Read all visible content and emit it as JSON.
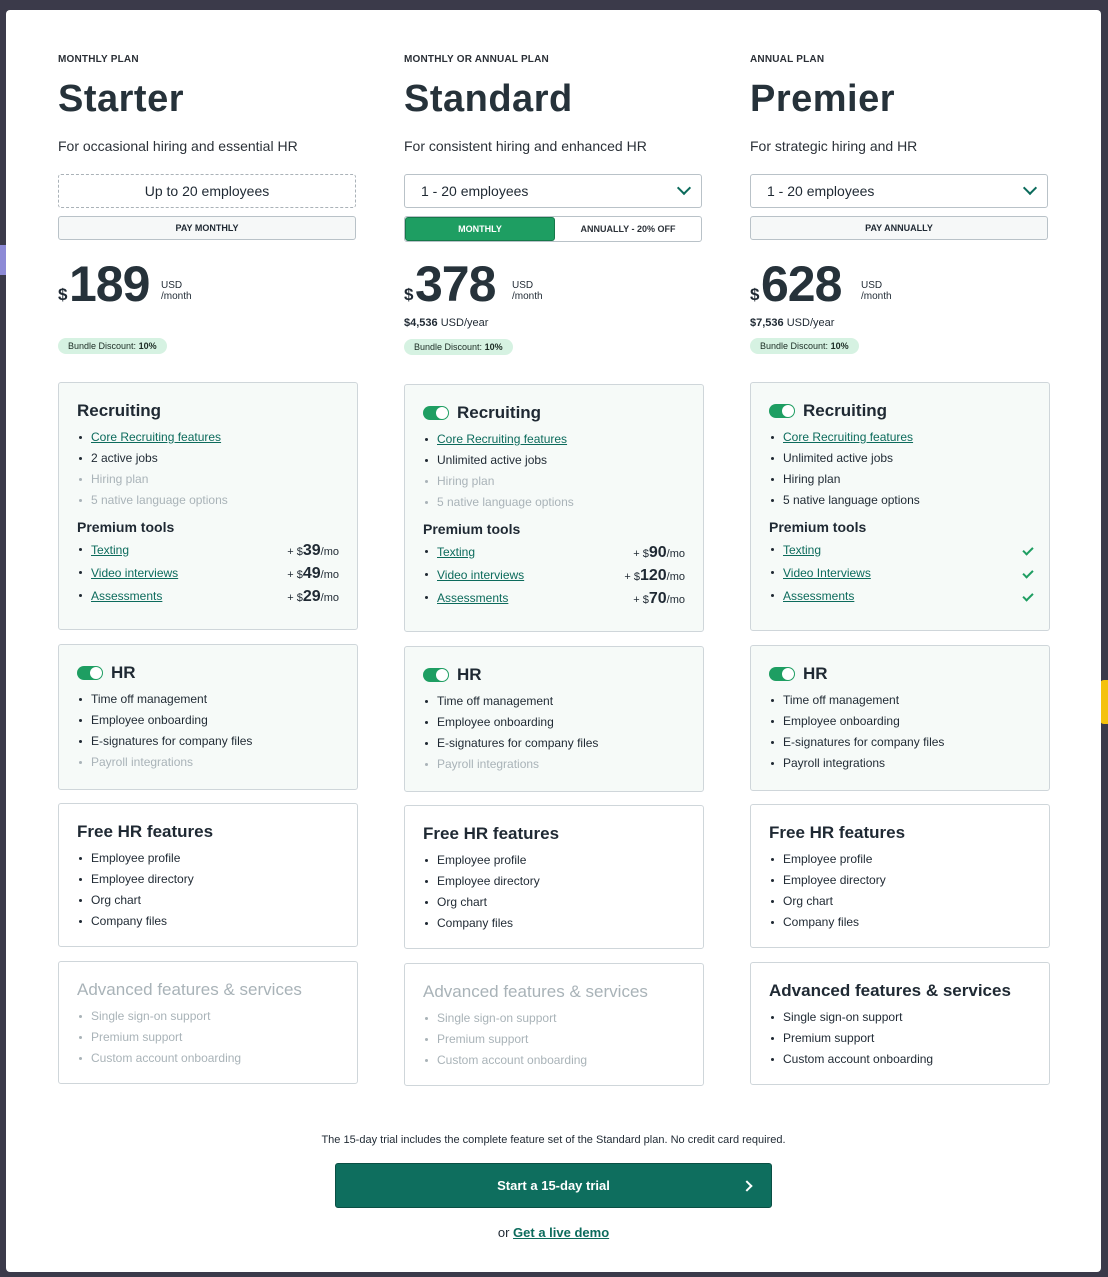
{
  "plans": [
    {
      "eyebrow": "MONTHLY PLAN",
      "name": "Starter",
      "desc": "For occasional hiring and essential HR",
      "employees": "Up to 20 employees",
      "pay": "PAY MONTHLY",
      "currency": "$",
      "amount": "189",
      "unit_a": "USD",
      "unit_b": "/month",
      "bundle_label": "Bundle Discount:",
      "bundle_value": "10%",
      "recruiting": {
        "title": "Recruiting",
        "items": [
          "Core Recruiting features",
          "2 active jobs",
          "Hiring plan",
          "5 native language options"
        ],
        "premium_title": "Premium tools",
        "premium": [
          {
            "name": "Texting",
            "plus": "+ $",
            "price": "39",
            "per": "/mo"
          },
          {
            "name": "Video interviews",
            "plus": "+ $",
            "price": "49",
            "per": "/mo"
          },
          {
            "name": "Assessments",
            "plus": "+ $",
            "price": "29",
            "per": "/mo"
          }
        ]
      },
      "hr": {
        "title": "HR",
        "items": [
          "Time off management",
          "Employee onboarding",
          "E-signatures for company files",
          "Payroll integrations"
        ]
      },
      "free": {
        "title": "Free HR features",
        "items": [
          "Employee profile",
          "Employee directory",
          "Org chart",
          "Company files"
        ]
      },
      "advanced": {
        "title": "Advanced features & services",
        "items": [
          "Single sign-on support",
          "Premium support",
          "Custom account onboarding"
        ]
      }
    },
    {
      "eyebrow": "MONTHLY OR ANNUAL PLAN",
      "name": "Standard",
      "desc": "For consistent hiring and enhanced HR",
      "employees": "1 - 20 employees",
      "seg_on": "MONTHLY",
      "seg_off": "ANNUALLY - 20% OFF",
      "currency": "$",
      "amount": "378",
      "unit_a": "USD",
      "unit_b": "/month",
      "yearly_amount": "$4,536",
      "yearly_unit": "USD/year",
      "bundle_label": "Bundle Discount:",
      "bundle_value": "10%",
      "recruiting": {
        "title": "Recruiting",
        "items": [
          "Core Recruiting features",
          "Unlimited active jobs",
          "Hiring plan",
          "5 native language options"
        ],
        "premium_title": "Premium tools",
        "premium": [
          {
            "name": "Texting",
            "plus": "+ $",
            "price": "90",
            "per": "/mo"
          },
          {
            "name": "Video interviews",
            "plus": "+ $",
            "price": "120",
            "per": "/mo"
          },
          {
            "name": "Assessments",
            "plus": "+ $",
            "price": "70",
            "per": "/mo"
          }
        ]
      },
      "hr": {
        "title": "HR",
        "items": [
          "Time off management",
          "Employee onboarding",
          "E-signatures for company files",
          "Payroll integrations"
        ]
      },
      "free": {
        "title": "Free HR features",
        "items": [
          "Employee profile",
          "Employee directory",
          "Org chart",
          "Company files"
        ]
      },
      "advanced": {
        "title": "Advanced features & services",
        "items": [
          "Single sign-on support",
          "Premium support",
          "Custom account onboarding"
        ]
      }
    },
    {
      "eyebrow": "ANNUAL PLAN",
      "name": "Premier",
      "desc": "For strategic hiring and HR",
      "employees": "1 - 20 employees",
      "pay": "PAY ANNUALLY",
      "currency": "$",
      "amount": "628",
      "unit_a": "USD",
      "unit_b": "/month",
      "yearly_amount": "$7,536",
      "yearly_unit": "USD/year",
      "bundle_label": "Bundle Discount:",
      "bundle_value": "10%",
      "recruiting": {
        "title": "Recruiting",
        "items": [
          "Core Recruiting features",
          "Unlimited active jobs",
          "Hiring plan",
          "5 native language options"
        ],
        "premium_title": "Premium tools",
        "premium": [
          {
            "name": "Texting"
          },
          {
            "name": "Video Interviews"
          },
          {
            "name": "Assessments"
          }
        ]
      },
      "hr": {
        "title": "HR",
        "items": [
          "Time off management",
          "Employee onboarding",
          "E-signatures for company files",
          "Payroll integrations"
        ]
      },
      "free": {
        "title": "Free HR features",
        "items": [
          "Employee profile",
          "Employee directory",
          "Org chart",
          "Company files"
        ]
      },
      "advanced": {
        "title": "Advanced features & services",
        "items": [
          "Single sign-on support",
          "Premium support",
          "Custom account onboarding"
        ]
      }
    }
  ],
  "footer": {
    "trial_note": "The 15-day trial includes the complete feature set of the Standard plan. No credit card required.",
    "trial_button": "Start a 15-day trial",
    "demo_prefix": "or",
    "demo_link": "Get a live demo"
  },
  "colors": {
    "accent": "#0e6e5e",
    "toggle": "#1e9e62",
    "badge_bg": "#d6f2e2"
  }
}
